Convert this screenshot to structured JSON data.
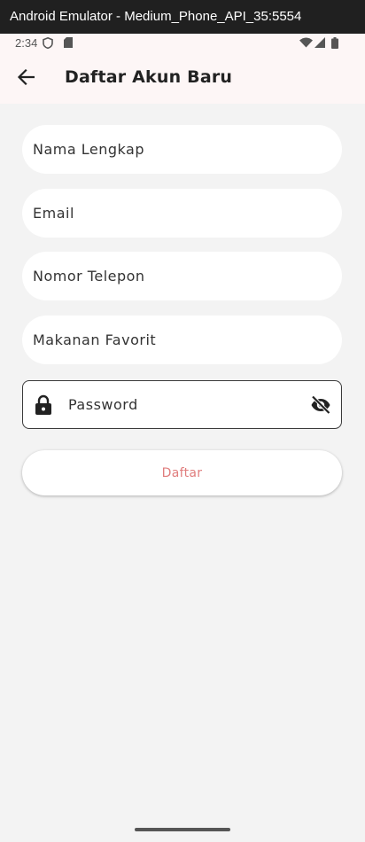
{
  "window": {
    "title": "Android Emulator - Medium_Phone_API_35:5554"
  },
  "status_bar": {
    "time": "2:34",
    "icons": [
      "shield-icon",
      "sd-card-icon",
      "wifi-icon",
      "signal-icon",
      "battery-icon"
    ]
  },
  "app_bar": {
    "back_icon": "arrow-back-icon",
    "title": "Daftar Akun Baru"
  },
  "form": {
    "full_name": {
      "placeholder": "Nama Lengkap",
      "value": ""
    },
    "email": {
      "placeholder": "Email",
      "value": ""
    },
    "phone": {
      "placeholder": "Nomor Telepon",
      "value": ""
    },
    "favorite_food": {
      "placeholder": "Makanan Favorit",
      "value": ""
    },
    "password": {
      "placeholder": "Password",
      "value": "",
      "prefix_icon": "lock-icon",
      "suffix_icon": "eye-off-icon"
    },
    "submit_label": "Daftar"
  },
  "colors": {
    "app_bar_bg": "#fdf6f6",
    "screen_bg": "#f3f3f3",
    "button_text": "#e07d7d"
  }
}
